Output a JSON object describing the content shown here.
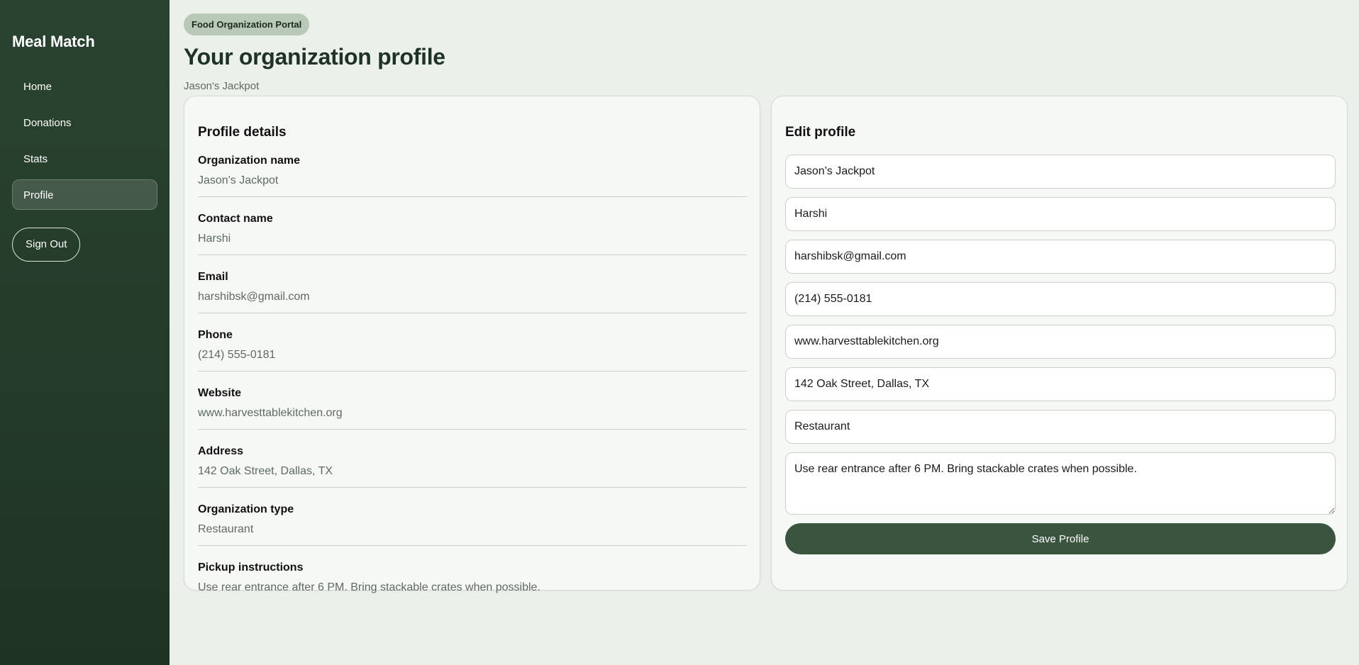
{
  "sidebar": {
    "brand": "Meal Match",
    "nav": [
      {
        "label": "Home"
      },
      {
        "label": "Donations"
      },
      {
        "label": "Stats"
      },
      {
        "label": "Profile"
      }
    ],
    "signout_label": "Sign Out"
  },
  "header": {
    "badge": "Food Organization Portal",
    "title": "Your organization profile",
    "subtitle": "Jason's Jackpot"
  },
  "details": {
    "title": "Profile details",
    "items": [
      {
        "label": "Organization name",
        "value": "Jason's Jackpot"
      },
      {
        "label": "Contact name",
        "value": "Harshi"
      },
      {
        "label": "Email",
        "value": "harshibsk@gmail.com"
      },
      {
        "label": "Phone",
        "value": "(214) 555-0181"
      },
      {
        "label": "Website",
        "value": "www.harvesttablekitchen.org"
      },
      {
        "label": "Address",
        "value": "142 Oak Street, Dallas, TX"
      },
      {
        "label": "Organization type",
        "value": "Restaurant"
      },
      {
        "label": "Pickup instructions",
        "value": "Use rear entrance after 6 PM. Bring stackable crates when possible."
      }
    ]
  },
  "edit": {
    "title": "Edit profile",
    "fields": {
      "org_name": "Jason's Jackpot",
      "contact_name": "Harshi",
      "email": "harshibsk@gmail.com",
      "phone": "(214) 555-0181",
      "website": "www.harvesttablekitchen.org",
      "address": "142 Oak Street, Dallas, TX",
      "org_type": "Restaurant",
      "pickup_instructions": "Use rear entrance after 6 PM. Bring stackable crates when possible."
    },
    "save_label": "Save Profile"
  },
  "colors": {
    "sidebar": "#243a2a",
    "accent": "#3a543f",
    "background": "#ebf0ea"
  }
}
